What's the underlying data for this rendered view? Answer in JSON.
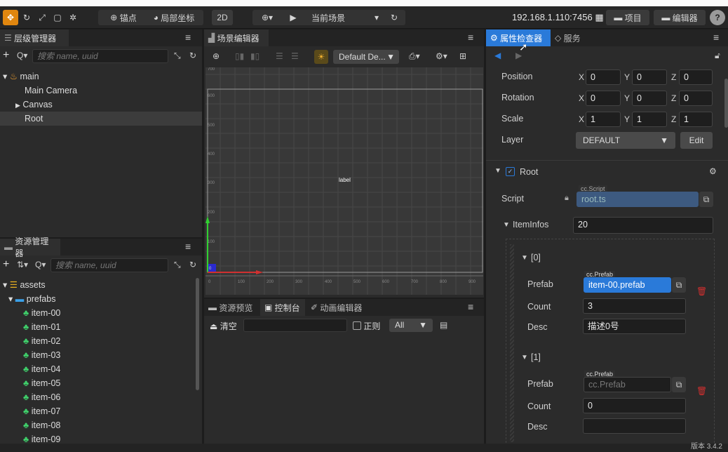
{
  "toolbar": {
    "anchor_label": "锚点",
    "local_coords_label": "局部坐标",
    "mode_2d": "2D",
    "scene_select": "当前场景",
    "host": "192.168.1.110:7456",
    "project_label": "项目",
    "editor_label": "编辑器",
    "help": "?"
  },
  "hierarchy": {
    "tab": "层级管理器",
    "search_placeholder": "搜索 name, uuid",
    "items": [
      {
        "label": "main"
      },
      {
        "label": "Main Camera"
      },
      {
        "label": "Canvas"
      },
      {
        "label": "Root"
      }
    ]
  },
  "assets": {
    "tab": "资源管理器",
    "search_placeholder": "搜索 name, uuid",
    "items": [
      {
        "label": "assets"
      },
      {
        "label": "prefabs"
      },
      {
        "label": "item-00"
      },
      {
        "label": "item-01"
      },
      {
        "label": "item-02"
      },
      {
        "label": "item-03"
      },
      {
        "label": "item-04"
      },
      {
        "label": "item-05"
      },
      {
        "label": "item-06"
      },
      {
        "label": "item-07"
      },
      {
        "label": "item-08"
      },
      {
        "label": "item-09"
      }
    ]
  },
  "scene": {
    "tab": "场景编辑器",
    "design_select": "Default De...",
    "label_text": "label",
    "y_ticks": [
      "700",
      "600",
      "500",
      "400",
      "300",
      "200",
      "100",
      "0"
    ],
    "x_ticks": [
      "0",
      "100",
      "200",
      "300",
      "400",
      "500",
      "600",
      "700",
      "800",
      "900"
    ]
  },
  "console": {
    "tabs": [
      "资源预览",
      "控制台",
      "动画编辑器"
    ],
    "clear_label": "清空",
    "regex_label": "正则",
    "level_select": "All"
  },
  "inspector": {
    "tab_active": "属性检查器",
    "tab_service": "服务",
    "position": {
      "label": "Position",
      "x": "0",
      "y": "0",
      "z": "0"
    },
    "rotation": {
      "label": "Rotation",
      "x": "0",
      "y": "0",
      "z": "0"
    },
    "scale": {
      "label": "Scale",
      "x": "1",
      "y": "1",
      "z": "1"
    },
    "layer": {
      "label": "Layer",
      "value": "DEFAULT",
      "edit": "Edit"
    },
    "component": {
      "name": "Root"
    },
    "script": {
      "label": "Script",
      "tag": "cc.Script",
      "value": "root.ts"
    },
    "item_infos": {
      "label": "ItemInfos",
      "count": "20"
    },
    "entries": [
      {
        "index": "[0]",
        "prefab_label": "Prefab",
        "prefab_tag": "cc.Prefab",
        "prefab_value": "item-00.prefab",
        "count_label": "Count",
        "count": "3",
        "desc_label": "Desc",
        "desc": "描述0号"
      },
      {
        "index": "[1]",
        "prefab_label": "Prefab",
        "prefab_tag": "cc.Prefab",
        "prefab_value": "cc.Prefab",
        "count_label": "Count",
        "count": "0",
        "desc_label": "Desc",
        "desc": ""
      }
    ]
  },
  "status": {
    "text": "版本 3.4.2"
  }
}
